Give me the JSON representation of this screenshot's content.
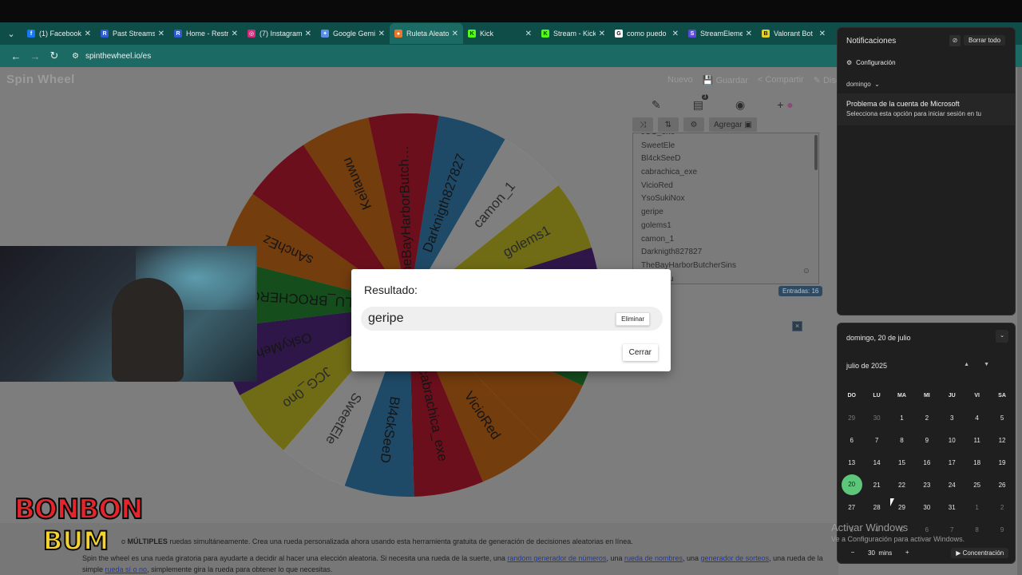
{
  "browser": {
    "tabs": [
      {
        "label": "(1) Facebook",
        "favicon": "facebook-icon",
        "color": "#1877f2",
        "glyph": "f"
      },
      {
        "label": "Past Streams",
        "favicon": "r-icon",
        "color": "#2f5bd3",
        "glyph": "R"
      },
      {
        "label": "Home - Restr",
        "favicon": "r-icon",
        "color": "#2f5bd3",
        "glyph": "R"
      },
      {
        "label": "(7) Instagram",
        "favicon": "instagram-icon",
        "color": "#d6297c",
        "glyph": "◎"
      },
      {
        "label": "Google Gemi",
        "favicon": "gemini-icon",
        "color": "#5c8ee6",
        "glyph": "✦"
      },
      {
        "label": "Ruleta Aleato",
        "favicon": "wheel-icon",
        "color": "#e8792b",
        "glyph": "●",
        "active": true
      },
      {
        "label": "Kick",
        "favicon": "kick-icon",
        "color": "#53fc18",
        "glyph": "K"
      },
      {
        "label": "Stream - Kick",
        "favicon": "kick-icon",
        "color": "#53fc18",
        "glyph": "K"
      },
      {
        "label": "como puedo",
        "favicon": "google-icon",
        "color": "#ffffff",
        "glyph": "G"
      },
      {
        "label": "StreamEleme",
        "favicon": "streamelements-icon",
        "color": "#5b4bd8",
        "glyph": "S"
      },
      {
        "label": "Valorant Bot",
        "favicon": "valorant-bot-icon",
        "color": "#e6d12b",
        "glyph": "B"
      }
    ],
    "url": "spinthewheel.io/es"
  },
  "site": {
    "logo": "Spin Wheel",
    "menu": [
      "Nuevo",
      "Guardar",
      "Compartir",
      "Dise"
    ]
  },
  "wheel": {
    "segments": [
      {
        "label": "Darknigth827827",
        "color": "#3f95cf"
      },
      {
        "label": "camon_1",
        "color": "#ffffff"
      },
      {
        "label": "golems1",
        "color": "#e1d82b"
      },
      {
        "label": "",
        "color": "#5d2e91"
      },
      {
        "label": "",
        "color": "#2b9a3b"
      },
      {
        "label": "",
        "color": "#e97a1d"
      },
      {
        "label": "VicioRed",
        "color": "#e97a1d"
      },
      {
        "label": "cabrachica_exe",
        "color": "#d81f38"
      },
      {
        "label": "Bl4ckSeeD",
        "color": "#3f95cf"
      },
      {
        "label": "SweetEle",
        "color": "#ffffff"
      },
      {
        "label": "JCG_0no",
        "color": "#e1d82b"
      },
      {
        "label": "OskyMeh",
        "color": "#5d2e91"
      },
      {
        "label": "CAMILU_BROCHERO",
        "color": "#2b9a3b"
      },
      {
        "label": "sAnchEz",
        "color": "#e97a1d"
      },
      {
        "label": "",
        "color": "#d81f38"
      },
      {
        "label": "Keilauwu",
        "color": "#e97a1d"
      },
      {
        "label": "TheBayHarborButch…",
        "color": "#d81f38"
      }
    ]
  },
  "tools": {
    "add_label": "Agregar",
    "badge": "3",
    "entries": [
      "JCG_0no",
      "SweetEle",
      "Bl4ckSeeD",
      "cabrachica_exe",
      "VicioRed",
      "YsoSukiNox",
      "geripe",
      "golems1",
      "camon_1",
      "Darknigth827827",
      "TheBayHarborButcherSins",
      "Keilauwu"
    ],
    "count_label": "Entradas: 16"
  },
  "modal": {
    "title": "Resultado:",
    "result": "geripe",
    "remove_label": "Eliminar",
    "close_label": "Cerrar"
  },
  "bottom": {
    "line1_pre": "o ",
    "line1_bold": "MÚLTIPLES",
    "line1_post": " ruedas simultáneamente. Crea una rueda personalizada ahora usando esta herramienta gratuita de generación de decisiones aleatorias en línea.",
    "line2_a": "Spin the wheel es una rueda giratoria para ayudarte a decidir al hacer una elección aleatoria. Si necesita una rueda de la suerte, una ",
    "line2_link1": "random generador de números",
    "line2_b": ", una ",
    "line2_link2": "rueda de nombres",
    "line2_c": ", una ",
    "line2_link3": "generador de sorteos",
    "line2_d": ", una rueda de la",
    "line3_a": "simple ",
    "line3_link": "rueda sí o no",
    "line3_b": ", simplemente gira la rueda para obtener lo que necesitas.",
    "brand_top": "BONBON",
    "brand_bottom": "BUM"
  },
  "notifications": {
    "title": "Notificaciones",
    "clear_all": "Borrar todo",
    "config": "Configuración",
    "day": "domingo",
    "card_title": "Problema de la cuenta de Microsoft",
    "card_body": "Selecciona esta opción para iniciar sesión en tu"
  },
  "calendar": {
    "date": "domingo, 20 de julio",
    "month": "julio de 2025",
    "weekdays": [
      "DO",
      "LU",
      "MA",
      "MI",
      "JU",
      "VI",
      "SA"
    ],
    "weeks": [
      [
        "29",
        "30",
        "1",
        "2",
        "3",
        "4",
        "5"
      ],
      [
        "6",
        "7",
        "8",
        "9",
        "10",
        "11",
        "12"
      ],
      [
        "13",
        "14",
        "15",
        "16",
        "17",
        "18",
        "19"
      ],
      [
        "20",
        "21",
        "22",
        "23",
        "24",
        "25",
        "26"
      ],
      [
        "27",
        "28",
        "29",
        "30",
        "31",
        "1",
        "2"
      ],
      [
        "3",
        "4",
        "5",
        "6",
        "7",
        "8",
        "9"
      ]
    ],
    "today": "20",
    "timer_value": "30",
    "timer_unit": "mins",
    "focus_label": "Concentración"
  },
  "watermark": {
    "line1": "Activar Windows",
    "line2": "Ve a Configuración para activar Windows."
  }
}
